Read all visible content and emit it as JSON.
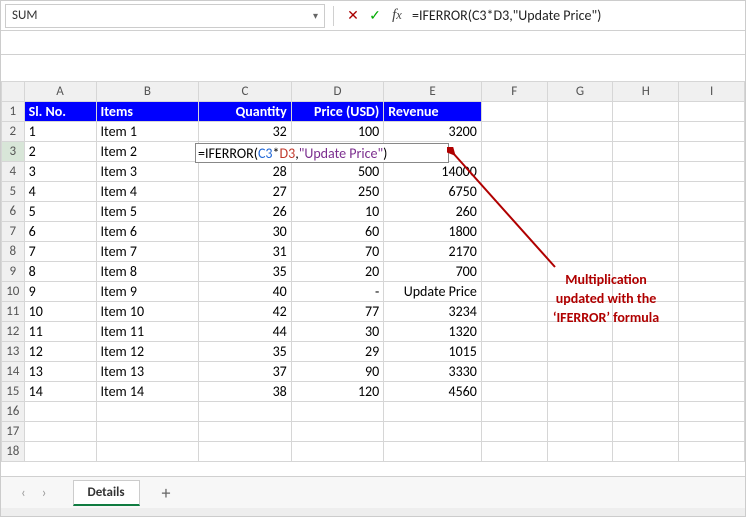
{
  "nameBox": "SUM",
  "formulaBar": "=IFERROR(C3*D3,\"Update Price\")",
  "editCell": {
    "prefix": "=IFERROR(",
    "ref1": "C3",
    "op": "*",
    "ref2": "D3",
    "comma": ",",
    "str": "\"Update Price\"",
    "suffix": ")"
  },
  "columns": [
    "A",
    "B",
    "C",
    "D",
    "E",
    "F",
    "G",
    "H",
    "I"
  ],
  "header": {
    "sl": "Sl. No.",
    "items": "Items",
    "qty": "Quantity",
    "price": "Price (USD)",
    "rev": "Revenue"
  },
  "rows": [
    {
      "n": "1",
      "sl": "1",
      "item": "Item 1",
      "qty": "32",
      "price": "100",
      "rev": "3200"
    },
    {
      "n": "2",
      "sl": "2",
      "item": "Item 2",
      "qty": "",
      "price": "",
      "rev": ""
    },
    {
      "n": "3",
      "sl": "3",
      "item": "Item 3",
      "qty": "28",
      "price": "500",
      "rev": "14000"
    },
    {
      "n": "4",
      "sl": "4",
      "item": "Item 4",
      "qty": "27",
      "price": "250",
      "rev": "6750"
    },
    {
      "n": "5",
      "sl": "5",
      "item": "Item 5",
      "qty": "26",
      "price": "10",
      "rev": "260"
    },
    {
      "n": "6",
      "sl": "6",
      "item": "Item 6",
      "qty": "30",
      "price": "60",
      "rev": "1800"
    },
    {
      "n": "7",
      "sl": "7",
      "item": "Item 7",
      "qty": "31",
      "price": "70",
      "rev": "2170"
    },
    {
      "n": "8",
      "sl": "8",
      "item": "Item 8",
      "qty": "35",
      "price": "20",
      "rev": "700"
    },
    {
      "n": "9",
      "sl": "9",
      "item": "Item 9",
      "qty": "40",
      "price": "-",
      "rev": "Update Price"
    },
    {
      "n": "10",
      "sl": "10",
      "item": "Item 10",
      "qty": "42",
      "price": "77",
      "rev": "3234"
    },
    {
      "n": "11",
      "sl": "11",
      "item": "Item 11",
      "qty": "44",
      "price": "30",
      "rev": "1320"
    },
    {
      "n": "12",
      "sl": "12",
      "item": "Item 12",
      "qty": "35",
      "price": "29",
      "rev": "1015"
    },
    {
      "n": "13",
      "sl": "13",
      "item": "Item 13",
      "qty": "37",
      "price": "90",
      "rev": "3330"
    },
    {
      "n": "14",
      "sl": "14",
      "item": "Item 14",
      "qty": "38",
      "price": "120",
      "rev": "4560"
    }
  ],
  "emptyRows": [
    "16",
    "17",
    "18"
  ],
  "annotation": {
    "line1": "Multiplication",
    "line2": "updated with the",
    "line3": "‘IFERROR’ formula"
  },
  "sheetTab": "Details"
}
